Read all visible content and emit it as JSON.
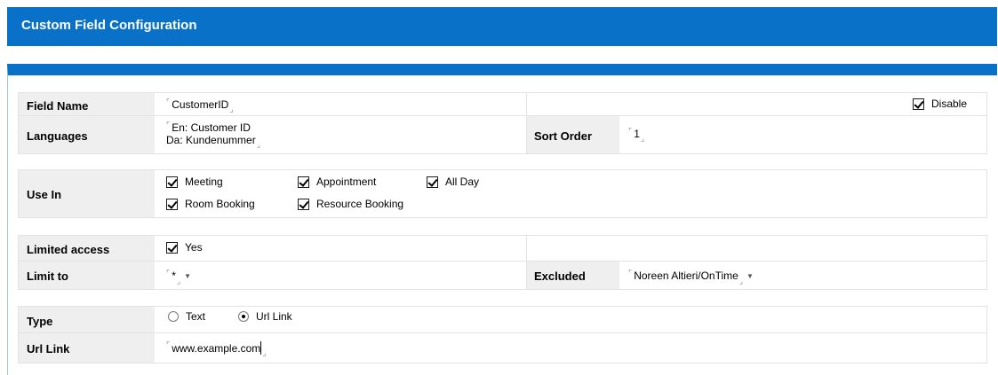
{
  "header": {
    "title": "Custom Field Configuration"
  },
  "colors": {
    "header_bar": "#0a71c9",
    "label_bg": "#efefef",
    "border": "#e3e3e3"
  },
  "icons": {
    "field_open": "corner-mark-open-icon",
    "field_close": "corner-mark-close-icon",
    "dropdown": "dropdown-arrow-icon"
  },
  "basic": {
    "field_name_label": "Field Name",
    "field_name_value": "CustomerID",
    "disable_label": "Disable",
    "disable_checked": true,
    "languages_label": "Languages",
    "languages_line1": "En: Customer ID",
    "languages_line2": "Da: Kundenummer",
    "sort_order_label": "Sort Order",
    "sort_order_value": "1"
  },
  "use_in": {
    "label": "Use In",
    "options": [
      {
        "label": "Meeting",
        "checked": true
      },
      {
        "label": "Appointment",
        "checked": true
      },
      {
        "label": "All Day",
        "checked": true
      },
      {
        "label": "Room Booking",
        "checked": true
      },
      {
        "label": "Resource Booking",
        "checked": true
      }
    ]
  },
  "access": {
    "limited_label": "Limited access",
    "limited_option": "Yes",
    "limited_checked": true,
    "limit_to_label": "Limit to",
    "limit_to_value": "*",
    "excluded_label": "Excluded",
    "excluded_value": "Noreen Altieri/OnTime"
  },
  "type": {
    "label": "Type",
    "options": [
      {
        "label": "Text",
        "selected": false
      },
      {
        "label": "Url Link",
        "selected": true
      }
    ],
    "url_label": "Url Link",
    "url_value": "www.example.com"
  }
}
